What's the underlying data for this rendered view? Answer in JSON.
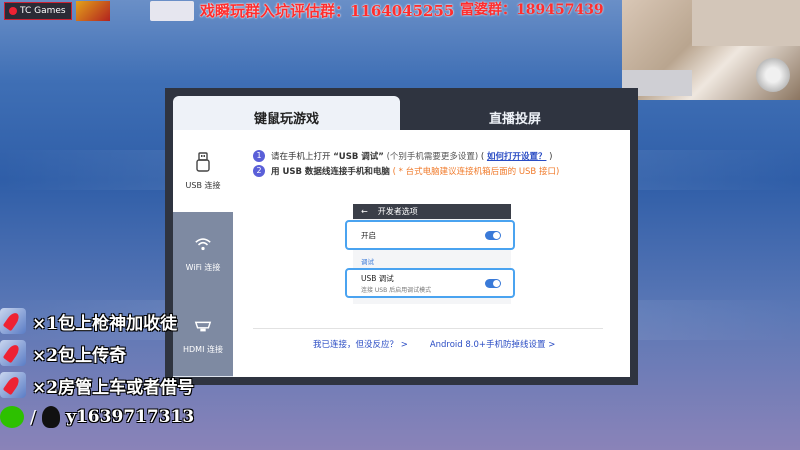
{
  "banner": {
    "app_tab": "TC Games",
    "group_text": "戏瞬玩群入坑评估群：1164045255",
    "rich_group": "富婆群：189457439"
  },
  "tabs": [
    {
      "label": "键鼠玩游戏",
      "active": true
    },
    {
      "label": "直播投屏",
      "active": false
    }
  ],
  "sidebar": {
    "items": [
      {
        "label": "USB 连接",
        "icon": "usb-icon"
      },
      {
        "label": "WiFi 连接",
        "icon": "wifi-icon"
      },
      {
        "label": "HDMI 连接",
        "icon": "hdmi-icon"
      }
    ]
  },
  "steps": {
    "step1_num": "1",
    "step1_prefix": "请在手机上打开",
    "step1_bold": "“USB 调试”",
    "step1_note": "(个别手机需要更多设置)",
    "step1_paren_open": "(",
    "step1_link": "如何打开设置？",
    "step1_paren_close": ")",
    "step2_num": "2",
    "step2_bold": "用 USB 数据线连接手机和电脑",
    "step2_warn": "( * 台式电脑建议连接机箱后面的 USB 接口)"
  },
  "phone": {
    "back": "←",
    "title": "开发者选项",
    "on_label": "开启",
    "section": "调试",
    "usb_label": "USB 调试",
    "usb_sub": "连接 USB 后启用调试模式"
  },
  "bottom": {
    "link1": "我已连接，但没反应？ >",
    "link2": "Android 8.0+手机防掉线设置 >"
  },
  "overlay": {
    "line1": "×1包上枪神加收徒",
    "line2": "×2包上传奇",
    "line3": "×2房管上车或者借号",
    "line4": "y1639717313",
    "slash": "/"
  },
  "colors": {
    "accent": "#5a5fd8",
    "link": "#2a4cc4",
    "warn": "#f07a2a",
    "toggle": "#3a7ad8",
    "highlight": "#4aa3f0"
  }
}
